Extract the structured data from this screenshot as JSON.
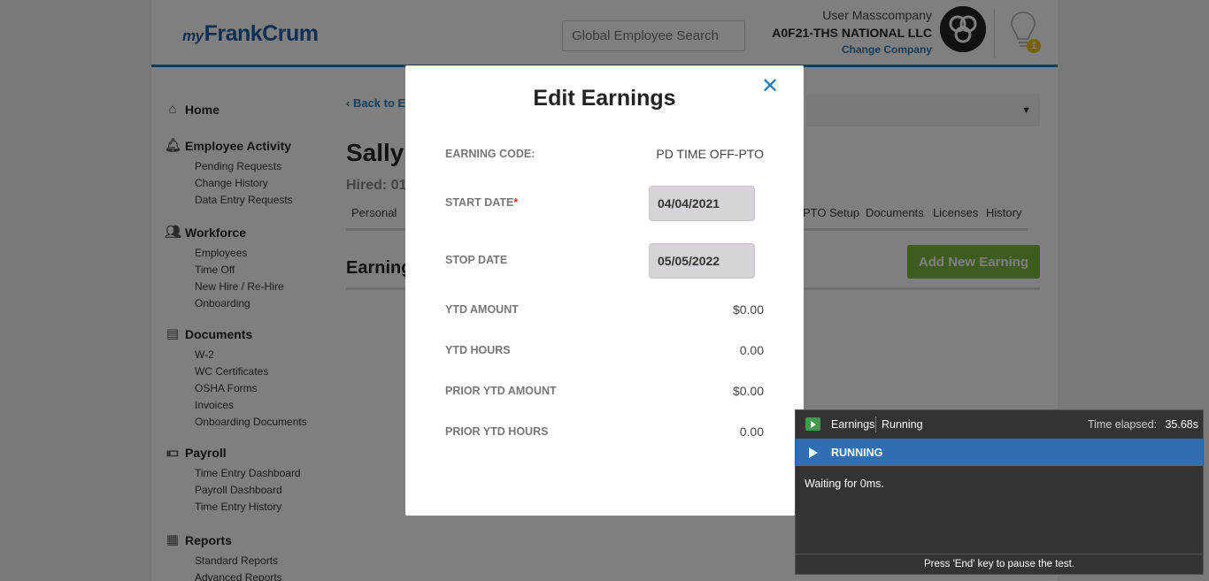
{
  "header": {
    "logo_prefix": "my",
    "logo_text": "FrankCrum",
    "search_placeholder": "Global Employee Search",
    "user_name": "User Masscompany",
    "company": "A0F21-THS NATIONAL LLC",
    "change_company": "Change Company",
    "notification_count": "1"
  },
  "sidebar": {
    "home": "Home",
    "employee_activity": {
      "label": "Employee Activity",
      "items": [
        "Pending Requests",
        "Change History",
        "Data Entry Requests"
      ]
    },
    "workforce": {
      "label": "Workforce",
      "items": [
        "Employees",
        "Time Off",
        "New Hire / Re-Hire",
        "Onboarding"
      ]
    },
    "documents": {
      "label": "Documents",
      "items": [
        "W-2",
        "WC Certificates",
        "OSHA Forms",
        "Invoices",
        "Onboarding Documents"
      ]
    },
    "payroll": {
      "label": "Payroll",
      "items": [
        "Time Entry Dashboard",
        "Payroll Dashboard",
        "Time Entry History"
      ]
    },
    "reports": {
      "label": "Reports",
      "items": [
        "Standard Reports",
        "Advanced Reports"
      ]
    }
  },
  "main": {
    "back_label": "Back to E",
    "employee_name": "Sally",
    "hired_label": "Hired: 01",
    "tabs": [
      "Personal",
      "PTO Setup",
      "Documents",
      "Licenses",
      "History"
    ],
    "section_title": "Earnings",
    "add_button": "Add New Earning"
  },
  "modal": {
    "title": "Edit Earnings",
    "earning_code_label": "EARNING CODE:",
    "earning_code_value": "PD TIME OFF-PTO",
    "start_date_label": "START DATE",
    "start_date_required": "*",
    "start_date_value": "04/04/2021",
    "stop_date_label": "STOP DATE",
    "stop_date_value": "05/05/2022",
    "ytd_amount_label": "YTD AMOUNT",
    "ytd_amount_value": "$0.00",
    "ytd_hours_label": "YTD HOURS",
    "ytd_hours_value": "0.00",
    "prior_ytd_amount_label": "PRIOR YTD AMOUNT",
    "prior_ytd_amount_value": "$0.00",
    "prior_ytd_hours_label": "PRIOR YTD HOURS",
    "prior_ytd_hours_value": "0.00"
  },
  "runner": {
    "name": "Earnings",
    "status": "Running",
    "elapsed_label": "Time elapsed:",
    "elapsed_value": "35.68s",
    "state": "RUNNING",
    "message": "Waiting for 0ms.",
    "footer": "Press 'End' key to pause the test."
  },
  "colors": {
    "accent": "#1f79b7",
    "add_button": "#7cb83f",
    "runner_state": "#2f6db5"
  }
}
